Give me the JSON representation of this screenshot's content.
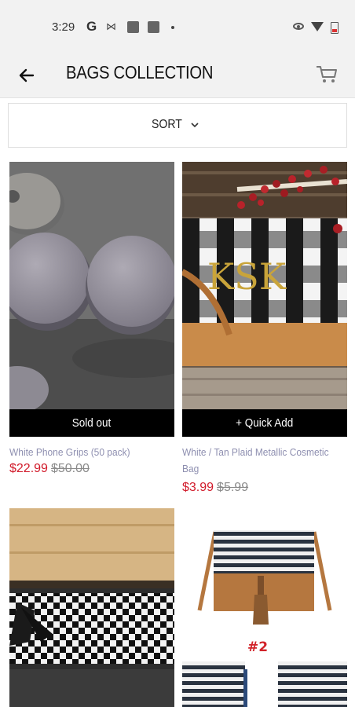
{
  "status_bar": {
    "time": "3:29",
    "g_glyph": "G",
    "m_glyph": "⋈"
  },
  "header": {
    "title": "BAGS COLLECTION"
  },
  "sort": {
    "label": "SORT"
  },
  "products": [
    {
      "name": "White Phone Grips (50 pack)",
      "sale": "$22.99",
      "original": "$50.00",
      "badge": "Sold out"
    },
    {
      "name": "White / Tan Plaid Metallic Cosmetic Bag",
      "sale": "$3.99",
      "original": "$5.99",
      "badge": "+ Quick Add",
      "monogram": "KSK"
    },
    {
      "name": "",
      "sale": "",
      "original": ""
    },
    {
      "name": "",
      "sale": "",
      "original": "",
      "image_label": "#2"
    }
  ],
  "colors": {
    "accent_price": "#d11a2a",
    "product_name": "#8e8fb0",
    "badge_bg": "#000000"
  },
  "icons": [
    "back-arrow-icon",
    "cart-icon",
    "chevron-down-icon"
  ]
}
